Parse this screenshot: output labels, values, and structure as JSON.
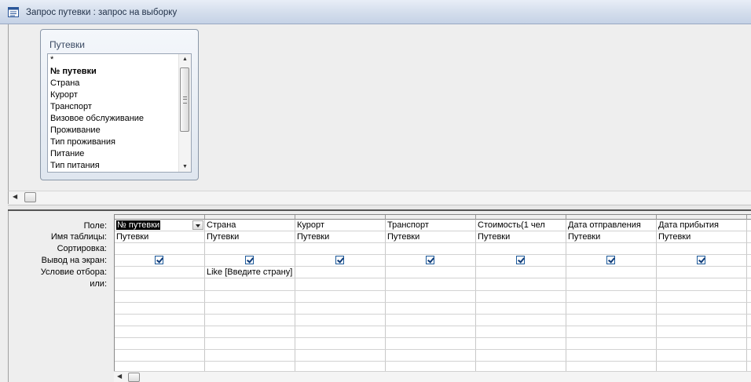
{
  "window": {
    "title": "Запрос путевки : запрос на выборку"
  },
  "table_box": {
    "title": "Путевки",
    "fields": [
      "*",
      "№ путевки",
      "Страна",
      "Курорт",
      "Транспорт",
      "Визовое обслуживание",
      "Проживание",
      "Тип проживания",
      "Питание",
      "Тип питания"
    ],
    "bold_field_index": 1
  },
  "grid": {
    "row_labels": [
      "Поле:",
      "Имя таблицы:",
      "Сортировка:",
      "Вывод на экран:",
      "Условие отбора:",
      "или:"
    ],
    "columns": [
      {
        "field": "№ путевки",
        "table": "Путевки",
        "sort": "",
        "show": true,
        "criteria": ""
      },
      {
        "field": "Страна",
        "table": "Путевки",
        "sort": "",
        "show": true,
        "criteria": "Like [Введите страну]"
      },
      {
        "field": "Курорт",
        "table": "Путевки",
        "sort": "",
        "show": true,
        "criteria": ""
      },
      {
        "field": "Транспорт",
        "table": "Путевки",
        "sort": "",
        "show": true,
        "criteria": ""
      },
      {
        "field": "Стоимость(1 чел",
        "table": "Путевки",
        "sort": "",
        "show": true,
        "criteria": ""
      },
      {
        "field": "Дата отправления",
        "table": "Путевки",
        "sort": "",
        "show": true,
        "criteria": ""
      },
      {
        "field": "Дата прибытия",
        "table": "Путевки",
        "sort": "",
        "show": true,
        "criteria": ""
      }
    ]
  },
  "icons": {
    "window_icon": "query-window-icon",
    "dropdown": "chevron-down-icon",
    "checkbox": "checkbox-checked-icon"
  }
}
